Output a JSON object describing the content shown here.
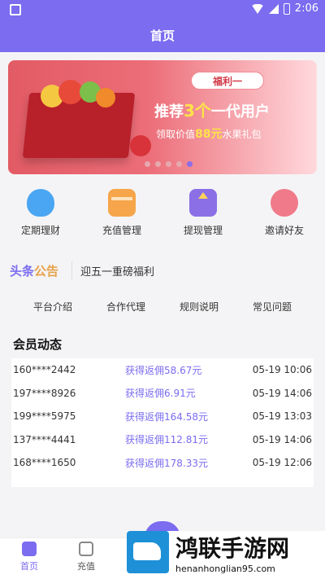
{
  "status_bar": {
    "time": "2:06"
  },
  "header": {
    "title": "首页"
  },
  "banner": {
    "pill": "福利一",
    "line1_pre": "推荐",
    "line1_num": "3个",
    "line1_post": "一代用户",
    "line2_pre": "领取价值",
    "line2_amount": "88元",
    "line2_post": "水果礼包",
    "dots": 5,
    "active_dot": 4
  },
  "quick_actions": [
    {
      "label": "定期理财",
      "icon": "piggy-bank-icon"
    },
    {
      "label": "充值管理",
      "icon": "card-icon"
    },
    {
      "label": "提现管理",
      "icon": "withdraw-icon"
    },
    {
      "label": "邀请好友",
      "icon": "invite-icon"
    }
  ],
  "notice": {
    "tag_a": "头条",
    "tag_b": "公告",
    "text": "迎五一重磅福利"
  },
  "links": [
    "平台介绍",
    "合作代理",
    "规则说明",
    "常见问题"
  ],
  "member": {
    "title": "会员动态",
    "rows": [
      {
        "phone": "160****2442",
        "action": "获得返佣58.67元",
        "time": "05-19 10:06"
      },
      {
        "phone": "197****8926",
        "action": "获得返佣6.91元",
        "time": "05-19 14:06"
      },
      {
        "phone": "199****5975",
        "action": "获得返佣164.58元",
        "time": "05-19 13:03"
      },
      {
        "phone": "137****4441",
        "action": "获得返佣112.81元",
        "time": "05-19 14:06"
      },
      {
        "phone": "168****1650",
        "action": "获得返佣178.33元",
        "time": "05-19 12:06"
      }
    ]
  },
  "bottom_nav": [
    {
      "label": "首页",
      "active": true
    },
    {
      "label": "充值",
      "active": false
    }
  ],
  "watermark": {
    "text": "鸿联手游网",
    "url": "henanhonglian95.com"
  }
}
